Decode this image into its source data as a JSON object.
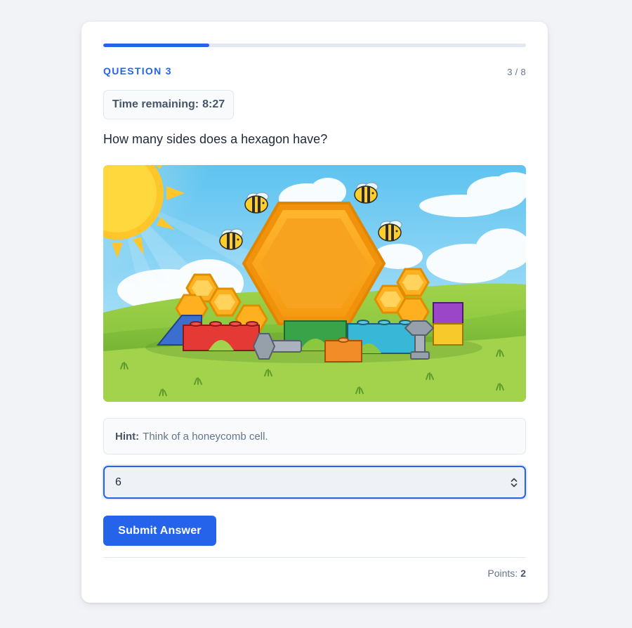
{
  "quiz": {
    "question_label": "QUESTION 3",
    "question_count": "3 / 8",
    "progress_fraction": 0.25,
    "timer_label": "Time remaining:",
    "timer_value": "8:27",
    "question_text": "How many sides does a hexagon have?",
    "hint_label": "Hint:",
    "hint_text": "Think of a honeycomb cell.",
    "answer_value": "6",
    "submit_label": "Submit Answer",
    "points_label": "Points:",
    "points_value": "2"
  },
  "colors": {
    "accent": "#2563eb",
    "page_background": "#f1f3f6",
    "card_background": "#ffffff"
  },
  "icons": {
    "spinner": "updown-chevron-icon"
  }
}
